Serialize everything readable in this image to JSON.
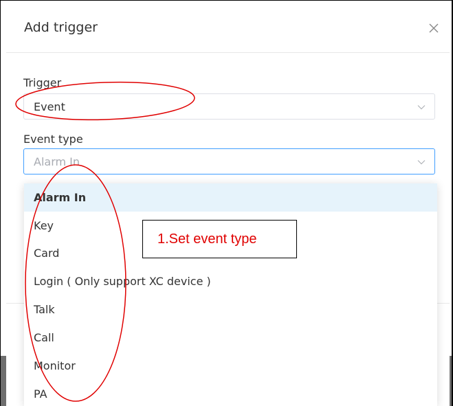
{
  "dialog": {
    "title": "Add trigger",
    "close_icon": "close-icon"
  },
  "trigger": {
    "label": "Trigger",
    "value": "Event"
  },
  "event_type": {
    "label": "Event type",
    "placeholder": "Alarm In",
    "options": [
      "Alarm In",
      "Key",
      "Card",
      "Login ( Only support XC device )",
      "Talk",
      "Call",
      "Monitor",
      "PA"
    ],
    "selected": "Alarm In"
  },
  "annotation": {
    "text": "1.Set event type",
    "color": "#e00000"
  },
  "colors": {
    "focus_border": "#409eff",
    "selected_option_bg": "#e6f3fb"
  }
}
